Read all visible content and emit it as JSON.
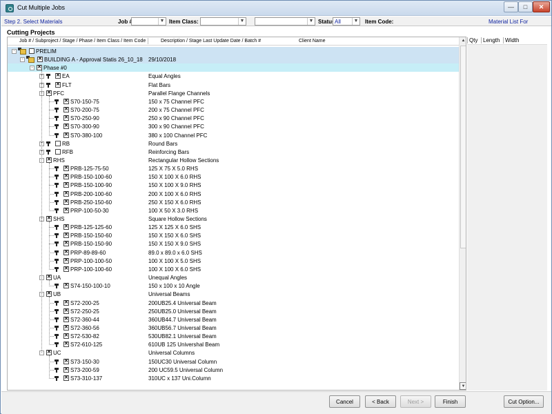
{
  "window": {
    "title": "Cut Multiple Jobs",
    "buttons": {
      "minimize": "—",
      "maximize": "□",
      "close": "✕"
    }
  },
  "filter_bar": {
    "step": "Step 2. Select Materials",
    "job_label": "Job #:",
    "job_value": "",
    "item_class_label": "Item Class:",
    "item_class_value": "",
    "extra_value": "",
    "status_label": "Status:",
    "status_value": "All",
    "item_code_label": "Item Code:",
    "material_list_label": "Material List For"
  },
  "section_title": "Cutting Projects",
  "tree_header": {
    "col1": "Job # / Subproject / Stage / Phase / Item Class / Item Code",
    "col2": "Description / Stage Last Update Date / Batch #",
    "col3": "Client Name"
  },
  "right_header": {
    "qty": "Qty",
    "length": "Length",
    "width": "Width"
  },
  "tree_rows": [
    {
      "level": 0,
      "label": "PRELIM",
      "desc": "",
      "checked": false,
      "exp": "-",
      "icon": "job",
      "hl": "hl"
    },
    {
      "level": 1,
      "label": "BUILDING A - Approval Statis 26_10_18",
      "desc": "29/10/2018",
      "checked": true,
      "exp": "-",
      "icon": "job",
      "hl": "hl"
    },
    {
      "level": 2,
      "label": "Phase #0",
      "desc": "",
      "checked": true,
      "exp": "-",
      "icon": "none",
      "hl": "hl2"
    },
    {
      "level": 3,
      "label": "EA",
      "desc": "Equal Angles",
      "checked": true,
      "exp": "+",
      "icon": "tool",
      "hl": ""
    },
    {
      "level": 3,
      "label": "FLT",
      "desc": "Flat Bars",
      "checked": true,
      "exp": "+",
      "icon": "tool",
      "hl": ""
    },
    {
      "level": 3,
      "label": "PFC",
      "desc": "Parallel Flange Channels",
      "checked": true,
      "exp": "-",
      "icon": "none",
      "hl": ""
    },
    {
      "level": 4,
      "label": "S70-150-75",
      "desc": "150 x 75 Channel PFC",
      "checked": true,
      "exp": "",
      "icon": "tool",
      "hl": ""
    },
    {
      "level": 4,
      "label": "S70-200-75",
      "desc": "200 x 75 Channel PFC",
      "checked": true,
      "exp": "",
      "icon": "tool",
      "hl": ""
    },
    {
      "level": 4,
      "label": "S70-250-90",
      "desc": "250 x 90 Channel PFC",
      "checked": true,
      "exp": "",
      "icon": "tool",
      "hl": ""
    },
    {
      "level": 4,
      "label": "S70-300-90",
      "desc": "300 x 90 Channel PFC",
      "checked": true,
      "exp": "",
      "icon": "tool",
      "hl": ""
    },
    {
      "level": 4,
      "label": "S70-380-100",
      "desc": "380 x 100 Channel PFC",
      "checked": true,
      "exp": "",
      "icon": "tool",
      "hl": ""
    },
    {
      "level": 3,
      "label": "RB",
      "desc": "Round Bars",
      "checked": false,
      "exp": "+",
      "icon": "tool",
      "hl": ""
    },
    {
      "level": 3,
      "label": "RFB",
      "desc": "Reinforcing Bars",
      "checked": false,
      "exp": "+",
      "icon": "tool",
      "hl": ""
    },
    {
      "level": 3,
      "label": "RHS",
      "desc": "Rectangular Hollow Sections",
      "checked": true,
      "exp": "-",
      "icon": "none",
      "hl": ""
    },
    {
      "level": 4,
      "label": "PRB-125-75-50",
      "desc": "125 X 75 X 5.0 RHS",
      "checked": true,
      "exp": "",
      "icon": "tool",
      "hl": ""
    },
    {
      "level": 4,
      "label": "PRB-150-100-60",
      "desc": "150 X 100 X 6.0 RHS",
      "checked": true,
      "exp": "",
      "icon": "tool",
      "hl": ""
    },
    {
      "level": 4,
      "label": "PRB-150-100-90",
      "desc": "150 X 100 X 9.0 RHS",
      "checked": true,
      "exp": "",
      "icon": "tool",
      "hl": ""
    },
    {
      "level": 4,
      "label": "PRB-200-100-60",
      "desc": "200 X 100 X 6.0 RHS",
      "checked": true,
      "exp": "",
      "icon": "tool",
      "hl": ""
    },
    {
      "level": 4,
      "label": "PRB-250-150-60",
      "desc": "250 X 150 X 6.0 RHS",
      "checked": true,
      "exp": "",
      "icon": "tool",
      "hl": ""
    },
    {
      "level": 4,
      "label": "PRP-100-50-30",
      "desc": "100 X 50 X 3.0 RHS",
      "checked": true,
      "exp": "",
      "icon": "tool",
      "hl": ""
    },
    {
      "level": 3,
      "label": "SHS",
      "desc": "Square Hollow Sections",
      "checked": true,
      "exp": "-",
      "icon": "none",
      "hl": ""
    },
    {
      "level": 4,
      "label": "PRB-125-125-60",
      "desc": "125 X 125 X 6.0 SHS",
      "checked": true,
      "exp": "",
      "icon": "tool",
      "hl": ""
    },
    {
      "level": 4,
      "label": "PRB-150-150-60",
      "desc": "150 X 150 X 6.0 SHS",
      "checked": true,
      "exp": "",
      "icon": "tool",
      "hl": ""
    },
    {
      "level": 4,
      "label": "PRB-150-150-90",
      "desc": "150 X 150 X 9.0 SHS",
      "checked": true,
      "exp": "",
      "icon": "tool",
      "hl": ""
    },
    {
      "level": 4,
      "label": "PRP-89-89-60",
      "desc": "89.0 x 89.0 x 6.0 SHS",
      "checked": true,
      "exp": "",
      "icon": "tool",
      "hl": ""
    },
    {
      "level": 4,
      "label": "PRP-100-100-50",
      "desc": "100 X 100 X 5.0 SHS",
      "checked": true,
      "exp": "",
      "icon": "tool",
      "hl": ""
    },
    {
      "level": 4,
      "label": "PRP-100-100-60",
      "desc": "100 X 100 X 6.0 SHS",
      "checked": true,
      "exp": "",
      "icon": "tool",
      "hl": ""
    },
    {
      "level": 3,
      "label": "UA",
      "desc": "Unequal Angles",
      "checked": true,
      "exp": "-",
      "icon": "none",
      "hl": ""
    },
    {
      "level": 4,
      "label": "S74-150-100-10",
      "desc": "150 x 100 x 10 Angle",
      "checked": true,
      "exp": "",
      "icon": "tool",
      "hl": ""
    },
    {
      "level": 3,
      "label": "UB",
      "desc": "Universal Beams",
      "checked": true,
      "exp": "-",
      "icon": "none",
      "hl": ""
    },
    {
      "level": 4,
      "label": "S72-200-25",
      "desc": "200UB25.4 Universal Beam",
      "checked": true,
      "exp": "",
      "icon": "tool",
      "hl": ""
    },
    {
      "level": 4,
      "label": "S72-250-25",
      "desc": "250UB25.0 Universal Beam",
      "checked": true,
      "exp": "",
      "icon": "tool",
      "hl": ""
    },
    {
      "level": 4,
      "label": "S72-360-44",
      "desc": "360UB44.7 Universal Beam",
      "checked": true,
      "exp": "",
      "icon": "tool",
      "hl": ""
    },
    {
      "level": 4,
      "label": "S72-360-56",
      "desc": "360UB56.7 Universal Beam",
      "checked": true,
      "exp": "",
      "icon": "tool",
      "hl": ""
    },
    {
      "level": 4,
      "label": "S72-530-82",
      "desc": "530UB82.1 Universal Beam",
      "checked": true,
      "exp": "",
      "icon": "tool",
      "hl": ""
    },
    {
      "level": 4,
      "label": "S72-610-125",
      "desc": "610UB 125 Univershal Beam",
      "checked": true,
      "exp": "",
      "icon": "tool",
      "hl": ""
    },
    {
      "level": 3,
      "label": "UC",
      "desc": "Universal Columns",
      "checked": true,
      "exp": "-",
      "icon": "none",
      "hl": ""
    },
    {
      "level": 4,
      "label": "S73-150-30",
      "desc": "150UC30 Universal Column",
      "checked": true,
      "exp": "",
      "icon": "tool",
      "hl": ""
    },
    {
      "level": 4,
      "label": "S73-200-59",
      "desc": "200 UC59.5 Universal Column",
      "checked": true,
      "exp": "",
      "icon": "tool",
      "hl": ""
    },
    {
      "level": 4,
      "label": "S73-310-137",
      "desc": "310UC x 137 Uni.Column",
      "checked": true,
      "exp": "",
      "icon": "tool",
      "hl": ""
    }
  ],
  "buttons": {
    "cancel": "Cancel",
    "back": "< Back",
    "next": "Next >",
    "finish": "Finish",
    "cut_option": "Cut Option..."
  },
  "colors": {
    "row_highlight": "#cde3f3",
    "row_highlight_phase": "#c6eef7",
    "step_text": "#1024a0"
  }
}
